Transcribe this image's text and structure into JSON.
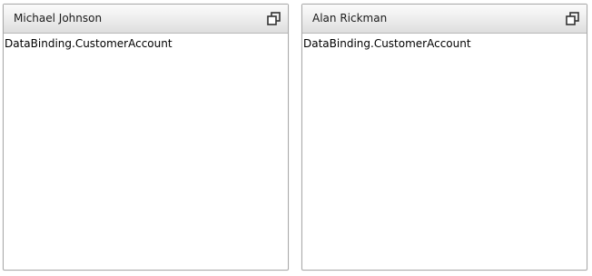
{
  "tiles": [
    {
      "header": "Michael Johnson",
      "content": "DataBinding.CustomerAccount",
      "button_icon": "restore-icon"
    },
    {
      "header": "Alan Rickman",
      "content": "DataBinding.CustomerAccount",
      "button_icon": "restore-icon"
    }
  ]
}
